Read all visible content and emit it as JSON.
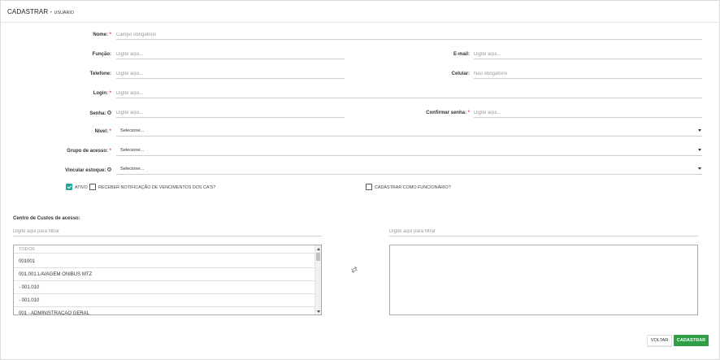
{
  "header": {
    "title": "CADASTRAR - ",
    "subtitle": "USUÁRIO"
  },
  "form": {
    "nome": {
      "label": "Nome:",
      "req": "*",
      "placeholder": "Campo obrigatório"
    },
    "funcao": {
      "label": "Função:",
      "placeholder": "Digite aqui..."
    },
    "email": {
      "label": "E-mail:",
      "placeholder": "Digite aqui..."
    },
    "telefone": {
      "label": "Telefone:",
      "placeholder": "Digite aqui..."
    },
    "celular": {
      "label": "Celular:",
      "placeholder": "Não obrigatório"
    },
    "login": {
      "label": "Login:",
      "req": "*",
      "placeholder": "Digite aqui..."
    },
    "senha": {
      "label": "Senha:",
      "info": "?",
      "placeholder": "Digite aqui..."
    },
    "confirmar_senha": {
      "label": "Confirmar senha:",
      "req": "*",
      "placeholder": "Digite aqui..."
    },
    "nivel": {
      "label": "Nível:",
      "req": "*",
      "value": "Selecione..."
    },
    "grupo_acesso": {
      "label": "Grupo de acesso:",
      "req": "*",
      "value": "Selecione..."
    },
    "vincular_estoque": {
      "label": "Vincular estoque:",
      "info": "?",
      "value": "Selecione..."
    }
  },
  "checkboxes": {
    "ativo": {
      "label": "Ativo",
      "checked": true
    },
    "notificacao": {
      "label": "Receber notificação de vencimentos dos CA's?",
      "checked": false
    },
    "funcionario": {
      "label": "Cadastrar como funcionário?",
      "checked": false
    }
  },
  "centro_custos": {
    "label": "Centro de Custos de acesso:",
    "left_filter_placeholder": "Digite aqui para filtrar",
    "right_filter_placeholder": "Digite aqui para filtrar",
    "list_header": "TODOS",
    "items": [
      "001001",
      "001.001.LAVAGEM ONIBUS MTZ",
      "- 001.010",
      "- 001.010",
      "001 - ADMINISTRACAO GERAL"
    ],
    "swap_icon": "swap-arrows-icon"
  },
  "buttons": {
    "back": "VOLTAR",
    "save": "CADASTRAR"
  },
  "colors": {
    "accent": "#26a69a",
    "save": "#2e9e47",
    "required": "#e53935"
  }
}
